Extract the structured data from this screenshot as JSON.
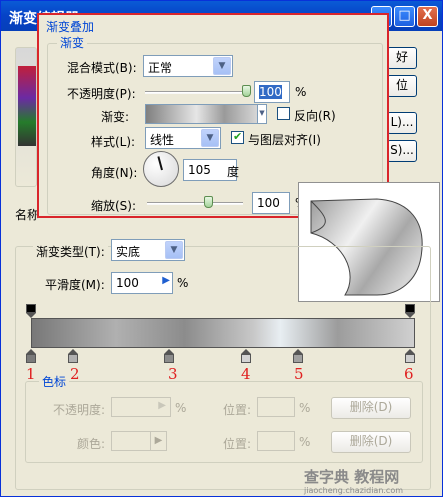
{
  "window": {
    "title": "渐变编辑器",
    "min_label": "_",
    "max_label": "□",
    "close_label": "X"
  },
  "overlay": {
    "title": "渐变叠加",
    "group": "渐变",
    "blend_label": "混合模式(B):",
    "blend_value": "正常",
    "opacity_label": "不透明度(P):",
    "opacity_value": "100",
    "opacity_unit": "%",
    "gradient_label": "渐变:",
    "reverse_label": "反向(R)",
    "style_label": "样式(L):",
    "style_value": "线性",
    "align_label": "与图层对齐(I)",
    "angle_label": "角度(N):",
    "angle_value": "105",
    "angle_unit": "度",
    "scale_label": "缩放(S):",
    "scale_value": "100",
    "scale_unit": "%"
  },
  "side_buttons": [
    "好",
    "位",
    "L)...",
    "S)..."
  ],
  "name_label": "名称",
  "gradient_type": {
    "label": "渐变类型(T):",
    "value": "实底",
    "smooth_label": "平滑度(M):",
    "smooth_value": "100",
    "smooth_unit": "%"
  },
  "stops": [
    "1",
    "2",
    "3",
    "4",
    "5",
    "6"
  ],
  "color_stops": {
    "label": "色标",
    "opacity_label": "不透明度:",
    "opacity_unit": "%",
    "position_label": "位置:",
    "position_unit": "%",
    "delete_label": "删除(D)",
    "color_label": "颜色:"
  },
  "watermark": {
    "line1": "查字典 教程网",
    "line2": "jiaocheng.chazidian.com"
  },
  "colors": {
    "accent": "#0046d5",
    "overlay_border": "#d9252b",
    "stop_number": "#e02020"
  }
}
